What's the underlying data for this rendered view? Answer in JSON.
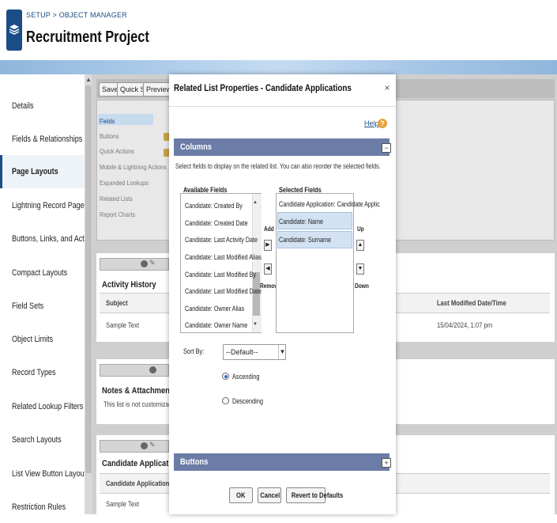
{
  "header": {
    "breadcrumb": "SETUP > OBJECT MANAGER",
    "title": "Recruitment Project",
    "icon": "layers-icon",
    "brand_color": "#1a4d86"
  },
  "sidebar": {
    "active": "Page Layouts",
    "items": [
      {
        "label": "Details"
      },
      {
        "label": "Fields & Relationships"
      },
      {
        "label": "Page Layouts"
      },
      {
        "label": "Lightning Record Pages"
      },
      {
        "label": "Buttons, Links, and Actions"
      },
      {
        "label": "Compact Layouts"
      },
      {
        "label": "Field Sets"
      },
      {
        "label": "Object Limits"
      },
      {
        "label": "Record Types"
      },
      {
        "label": "Related Lookup Filters"
      },
      {
        "label": "Search Layouts"
      },
      {
        "label": "List View Button Layout"
      },
      {
        "label": "Restriction Rules"
      }
    ]
  },
  "toolbar": {
    "save_label": "Save ▾",
    "quick_save_label": "Quick Save",
    "preview_label": "Preview As..."
  },
  "palette": {
    "items": [
      "Fields",
      "Buttons",
      "Quick Actions",
      "Mobile & Lightning Actions",
      "Expanded Lookups",
      "Related Lists",
      "Report Charts"
    ]
  },
  "canvas": {
    "activity_history": {
      "title": "Activity History",
      "col_subject": "Subject",
      "col_last_modified": "Last Modified Date/Time",
      "row_subject": "Sample Text",
      "row_last_modified": "15/04/2024, 1:07 pm"
    },
    "notes": {
      "title": "Notes & Attachments",
      "subtitle": "This list is not customizable"
    },
    "candidate_applications": {
      "title": "Candidate Applications",
      "col_first": "Candidate Application: Candidate A",
      "row_first": "Sample Text"
    }
  },
  "modal": {
    "title": "Related List Properties - Candidate Applications",
    "close": "×",
    "help": "Help",
    "help_glyph": "?",
    "columns_section": {
      "title": "Columns",
      "toggle": "−",
      "instructions": "Select fields to display on the related list. You can also reorder the selected fields.",
      "available_label": "Available Fields",
      "selected_label": "Selected Fields",
      "available_fields": [
        "Candidate: Created By",
        "Candidate: Created Date",
        "Candidate: Last Activity Date",
        "Candidate: Last Modified Alias",
        "Candidate: Last Modified By",
        "Candidate: Last Modified Date",
        "Candidate: Owner Alias",
        "Candidate: Owner Name"
      ],
      "selected_fields": [
        "Candidate Application: Candidate Applic",
        "Candidate: Name",
        "Candidate: Surname"
      ],
      "add_label": "Add",
      "remove_label": "Remove",
      "up_label": "Up",
      "down_label": "Down",
      "add_glyph": "▶",
      "remove_glyph": "◀",
      "up_glyph": "▲",
      "down_glyph": "▼"
    },
    "sort": {
      "label": "Sort By:",
      "value": "--Default--",
      "ascending": "Ascending",
      "descending": "Descending",
      "selected": "Ascending"
    },
    "buttons_section": {
      "title": "Buttons",
      "toggle": "+"
    },
    "footer": {
      "ok": "OK",
      "cancel": "Cancel",
      "revert": "Revert to Defaults"
    }
  }
}
